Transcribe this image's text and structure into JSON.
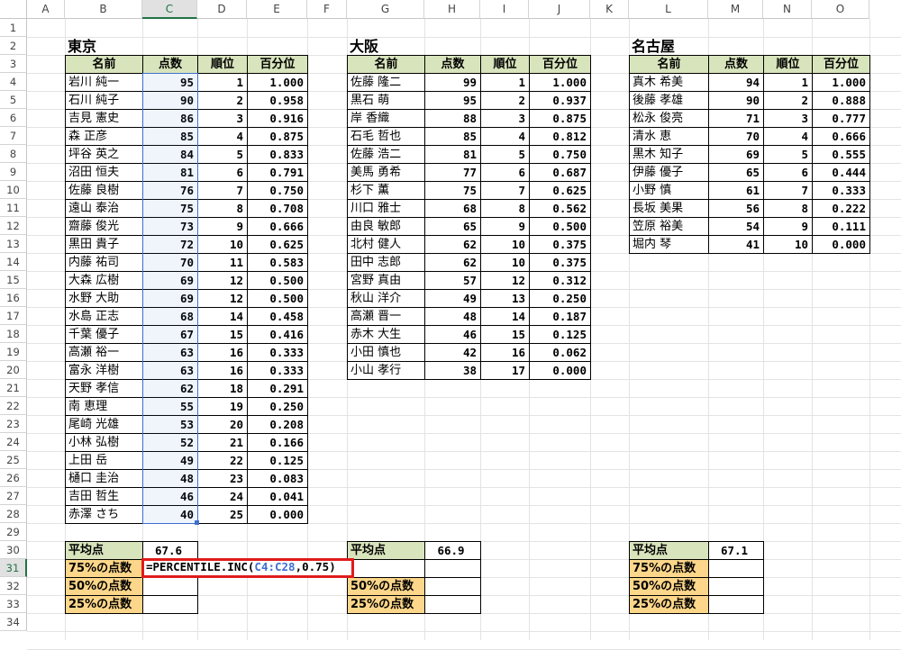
{
  "columns": [
    "A",
    "B",
    "C",
    "D",
    "E",
    "F",
    "G",
    "H",
    "I",
    "J",
    "K",
    "L",
    "M",
    "N",
    "O"
  ],
  "rows": [
    "1",
    "2",
    "3",
    "4",
    "5",
    "6",
    "7",
    "8",
    "9",
    "10",
    "11",
    "12",
    "13",
    "14",
    "15",
    "16",
    "17",
    "18",
    "19",
    "20",
    "21",
    "22",
    "23",
    "24",
    "25",
    "26",
    "27",
    "28",
    "29",
    "30",
    "31",
    "32",
    "33",
    "34"
  ],
  "headers": [
    "名前",
    "点数",
    "順位",
    "百分位"
  ],
  "colors": {
    "header_bg": "#d8e4bc",
    "label_bg": "#fcd68a",
    "highlight": "#e01b1b",
    "ref_blue": "#3d6fcf"
  },
  "tokyo": {
    "title": "東京",
    "rows": [
      [
        "岩川 純一",
        "95",
        "1",
        "1.000"
      ],
      [
        "石川 純子",
        "90",
        "2",
        "0.958"
      ],
      [
        "吉見 憲史",
        "86",
        "3",
        "0.916"
      ],
      [
        "森 正彦",
        "85",
        "4",
        "0.875"
      ],
      [
        "坪谷 英之",
        "84",
        "5",
        "0.833"
      ],
      [
        "沼田 恒夫",
        "81",
        "6",
        "0.791"
      ],
      [
        "佐藤 良樹",
        "76",
        "7",
        "0.750"
      ],
      [
        "遠山 泰治",
        "75",
        "8",
        "0.708"
      ],
      [
        "齋藤 俊光",
        "73",
        "9",
        "0.666"
      ],
      [
        "黒田 貴子",
        "72",
        "10",
        "0.625"
      ],
      [
        "内藤 祐司",
        "70",
        "11",
        "0.583"
      ],
      [
        "大森 広樹",
        "69",
        "12",
        "0.500"
      ],
      [
        "水野 大助",
        "69",
        "12",
        "0.500"
      ],
      [
        "水島 正志",
        "68",
        "14",
        "0.458"
      ],
      [
        "千葉 優子",
        "67",
        "15",
        "0.416"
      ],
      [
        "高瀬 裕一",
        "63",
        "16",
        "0.333"
      ],
      [
        "富永 洋樹",
        "63",
        "16",
        "0.333"
      ],
      [
        "天野 孝信",
        "62",
        "18",
        "0.291"
      ],
      [
        "南 恵理",
        "55",
        "19",
        "0.250"
      ],
      [
        "尾崎 光雄",
        "53",
        "20",
        "0.208"
      ],
      [
        "小林 弘樹",
        "52",
        "21",
        "0.166"
      ],
      [
        "上田 岳",
        "49",
        "22",
        "0.125"
      ],
      [
        "樋口 圭治",
        "48",
        "23",
        "0.083"
      ],
      [
        "吉田 哲生",
        "46",
        "24",
        "0.041"
      ],
      [
        "赤澤 さち",
        "40",
        "25",
        "0.000"
      ]
    ],
    "avg_label": "平均点",
    "avg": "67.6",
    "p75_label": "75%の点数",
    "p50_label": "50%の点数",
    "p25_label": "25%の点数",
    "formula_prefix": "=PERCENTILE.INC(",
    "formula_ref": "C4:C28",
    "formula_suffix": ",0.75)"
  },
  "osaka": {
    "title": "大阪",
    "rows": [
      [
        "佐藤 隆二",
        "99",
        "1",
        "1.000"
      ],
      [
        "黒石 萌",
        "95",
        "2",
        "0.937"
      ],
      [
        "岸 香織",
        "88",
        "3",
        "0.875"
      ],
      [
        "石毛 哲也",
        "85",
        "4",
        "0.812"
      ],
      [
        "佐藤 浩二",
        "81",
        "5",
        "0.750"
      ],
      [
        "美馬 勇希",
        "77",
        "6",
        "0.687"
      ],
      [
        "杉下 薫",
        "75",
        "7",
        "0.625"
      ],
      [
        "川口 雅士",
        "68",
        "8",
        "0.562"
      ],
      [
        "由良 敏郎",
        "65",
        "9",
        "0.500"
      ],
      [
        "北村 健人",
        "62",
        "10",
        "0.375"
      ],
      [
        "田中 志郎",
        "62",
        "10",
        "0.375"
      ],
      [
        "宮野 真由",
        "57",
        "12",
        "0.312"
      ],
      [
        "秋山 洋介",
        "49",
        "13",
        "0.250"
      ],
      [
        "高瀬 晋一",
        "48",
        "14",
        "0.187"
      ],
      [
        "赤木 大生",
        "46",
        "15",
        "0.125"
      ],
      [
        "小田 慎也",
        "42",
        "16",
        "0.062"
      ],
      [
        "小山 孝行",
        "38",
        "17",
        "0.000"
      ]
    ],
    "avg_label": "平均点",
    "avg": "66.9",
    "p50_label": "50%の点数",
    "p25_label": "25%の点数"
  },
  "nagoya": {
    "title": "名古屋",
    "rows": [
      [
        "真木 希美",
        "94",
        "1",
        "1.000"
      ],
      [
        "後藤 孝雄",
        "90",
        "2",
        "0.888"
      ],
      [
        "松永 俊亮",
        "71",
        "3",
        "0.777"
      ],
      [
        "清水 恵",
        "70",
        "4",
        "0.666"
      ],
      [
        "黒木 知子",
        "69",
        "5",
        "0.555"
      ],
      [
        "伊藤 優子",
        "65",
        "6",
        "0.444"
      ],
      [
        "小野 慎",
        "61",
        "7",
        "0.333"
      ],
      [
        "長坂 美果",
        "56",
        "8",
        "0.222"
      ],
      [
        "笠原 裕美",
        "54",
        "9",
        "0.111"
      ],
      [
        "堀内 琴",
        "41",
        "10",
        "0.000"
      ]
    ],
    "avg_label": "平均点",
    "avg": "67.1",
    "p75_label": "75%の点数",
    "p50_label": "50%の点数",
    "p25_label": "25%の点数"
  }
}
